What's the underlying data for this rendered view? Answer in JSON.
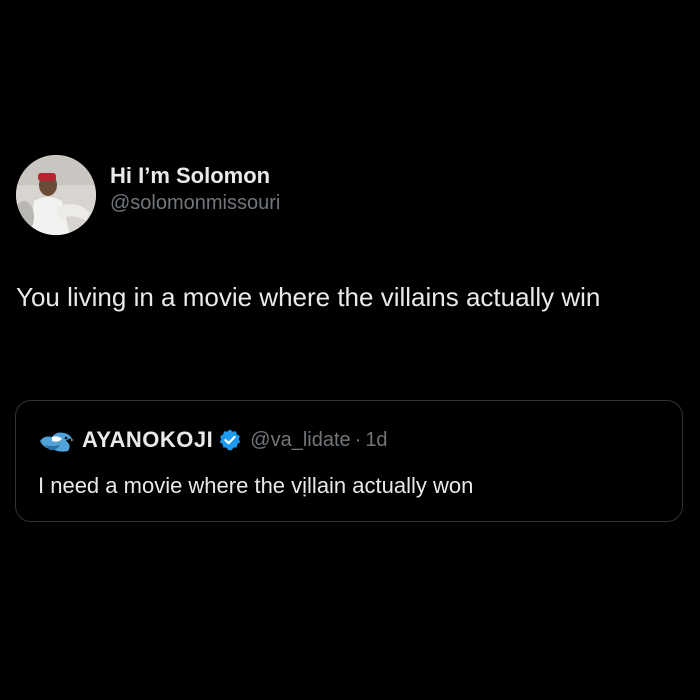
{
  "tweet": {
    "display_name": "Hi I’m Solomon",
    "handle": "@solomonmissouri",
    "text": "You living in a movie where the villains actually win"
  },
  "quote": {
    "display_name": "AYANOKOJI",
    "handle": "@va_lidate",
    "separator": "·",
    "time": "1d",
    "text": "I need a movie where the vịllain actually won",
    "verified_color": "#1d9bf0"
  },
  "icons": {
    "author_avatar": "avatar",
    "quote_avatar": "bird-emoji-icon",
    "verified": "verified-badge-icon"
  }
}
